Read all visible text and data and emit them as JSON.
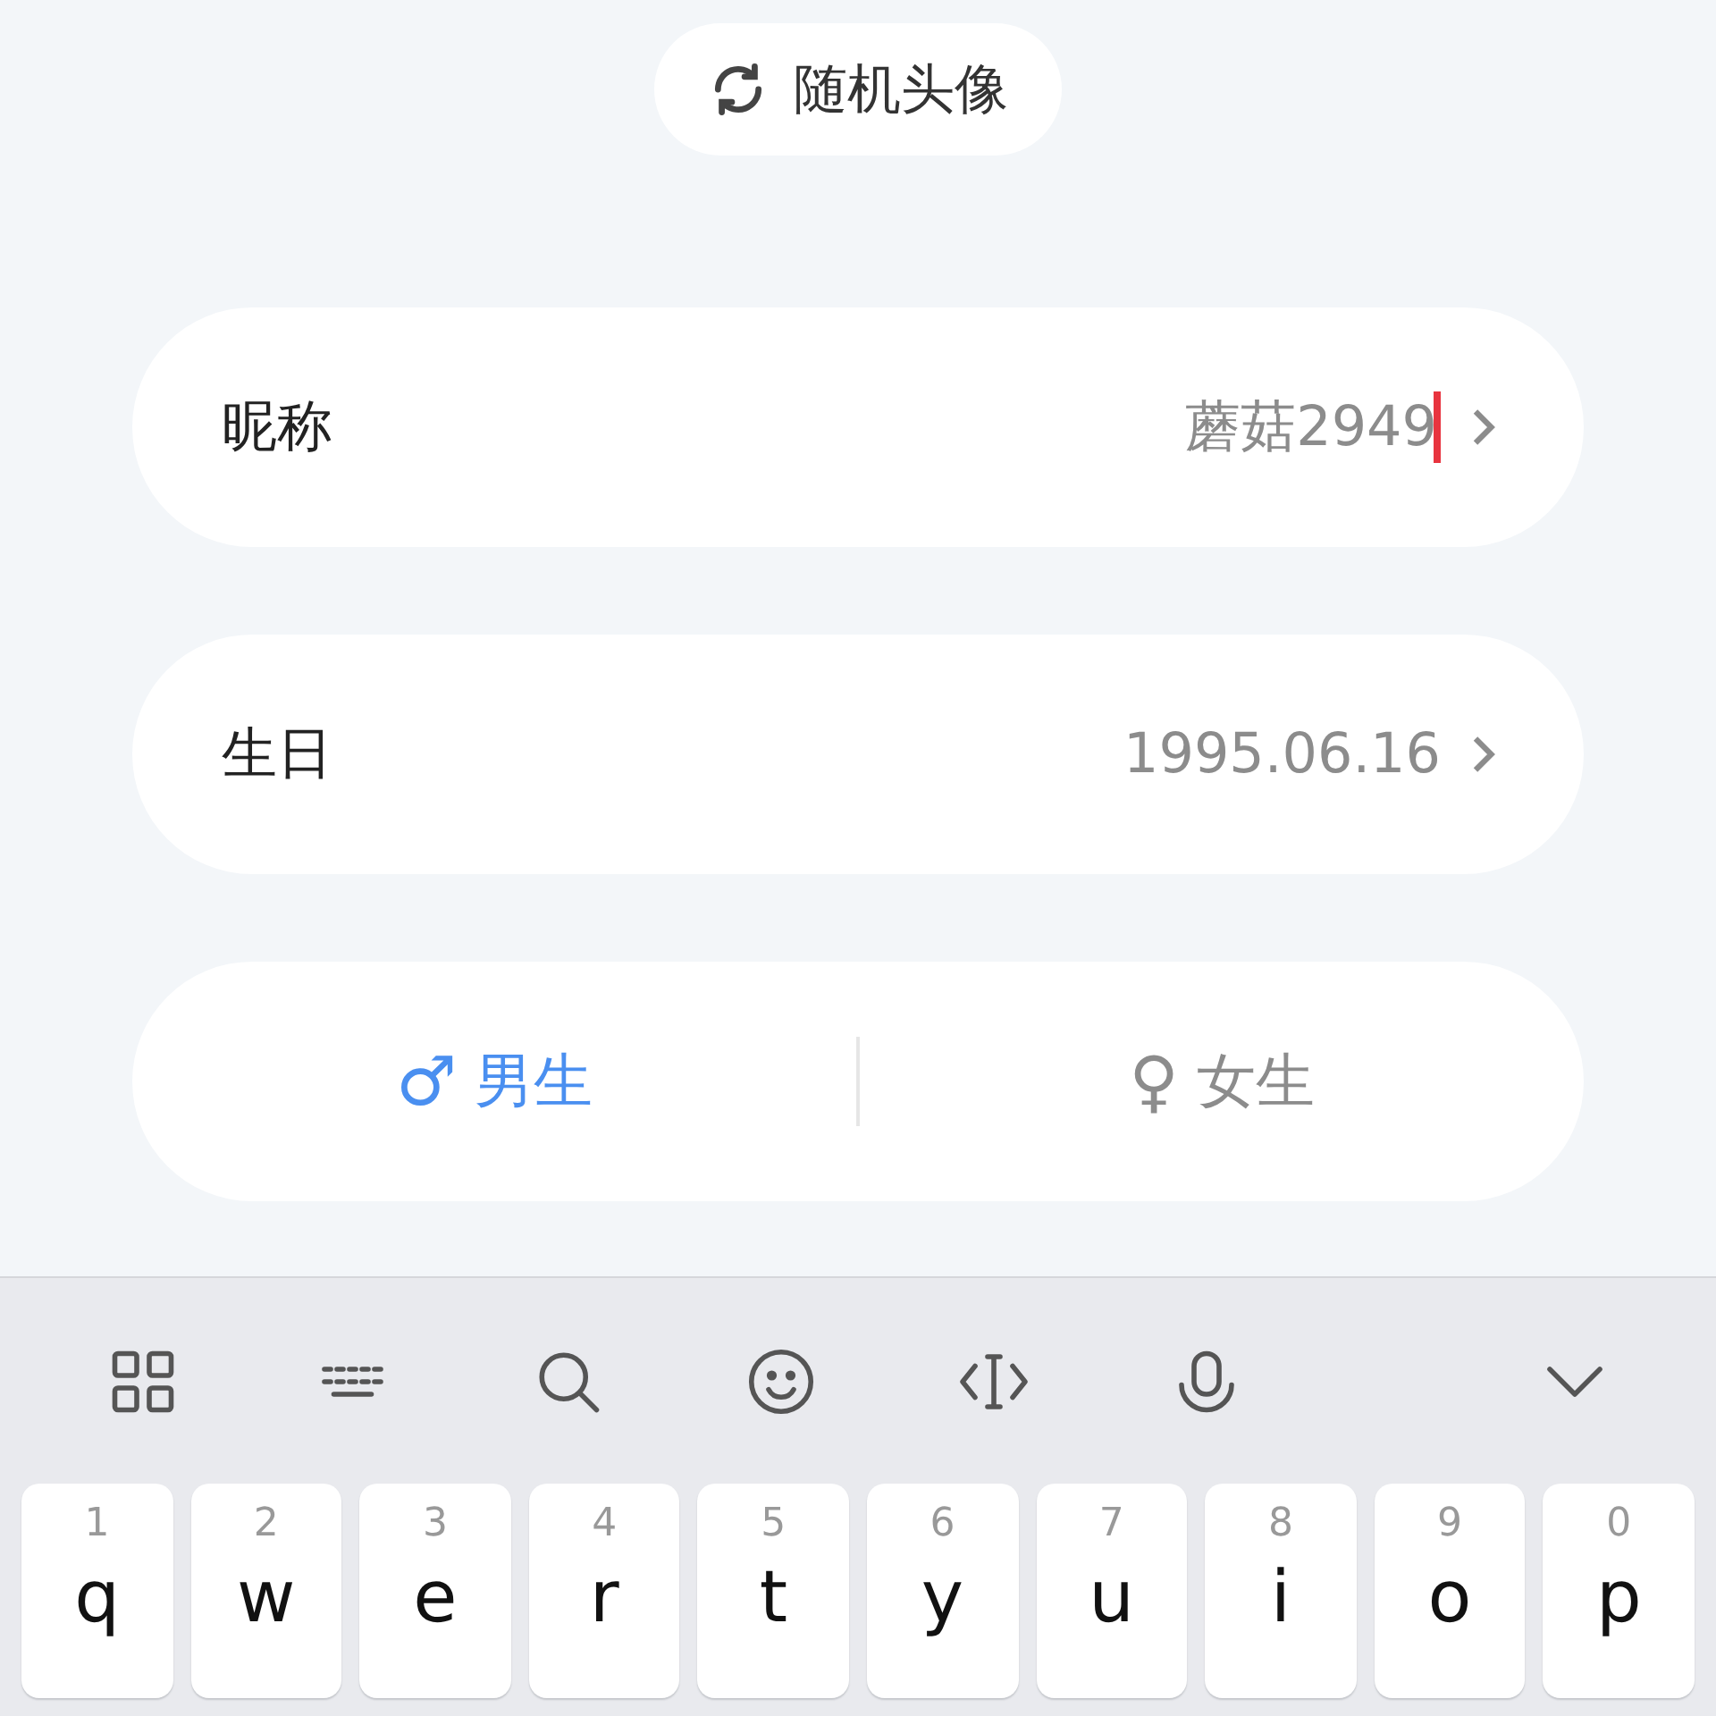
{
  "avatar_button": {
    "label": "随机头像"
  },
  "fields": [
    {
      "label": "昵称",
      "value": "蘑菇2949",
      "focused": true
    },
    {
      "label": "生日",
      "value": "1995.06.16",
      "focused": false
    }
  ],
  "gender": [
    {
      "symbol": "♂",
      "label": "男生",
      "selected": true
    },
    {
      "symbol": "♀",
      "label": "女生",
      "selected": false
    }
  ],
  "keyboard": {
    "toolbar": [
      {
        "kind": "grid"
      },
      {
        "kind": "keyboard"
      },
      {
        "kind": "search"
      },
      {
        "kind": "emoji"
      },
      {
        "kind": "cursor"
      },
      {
        "kind": "mic"
      },
      {
        "kind": "collapse"
      }
    ],
    "keys": [
      {
        "hint": "1",
        "letter": "q"
      },
      {
        "hint": "2",
        "letter": "w"
      },
      {
        "hint": "3",
        "letter": "e"
      },
      {
        "hint": "4",
        "letter": "r"
      },
      {
        "hint": "5",
        "letter": "t"
      },
      {
        "hint": "6",
        "letter": "y"
      },
      {
        "hint": "7",
        "letter": "u"
      },
      {
        "hint": "8",
        "letter": "i"
      },
      {
        "hint": "9",
        "letter": "o"
      },
      {
        "hint": "0",
        "letter": "p"
      }
    ]
  }
}
